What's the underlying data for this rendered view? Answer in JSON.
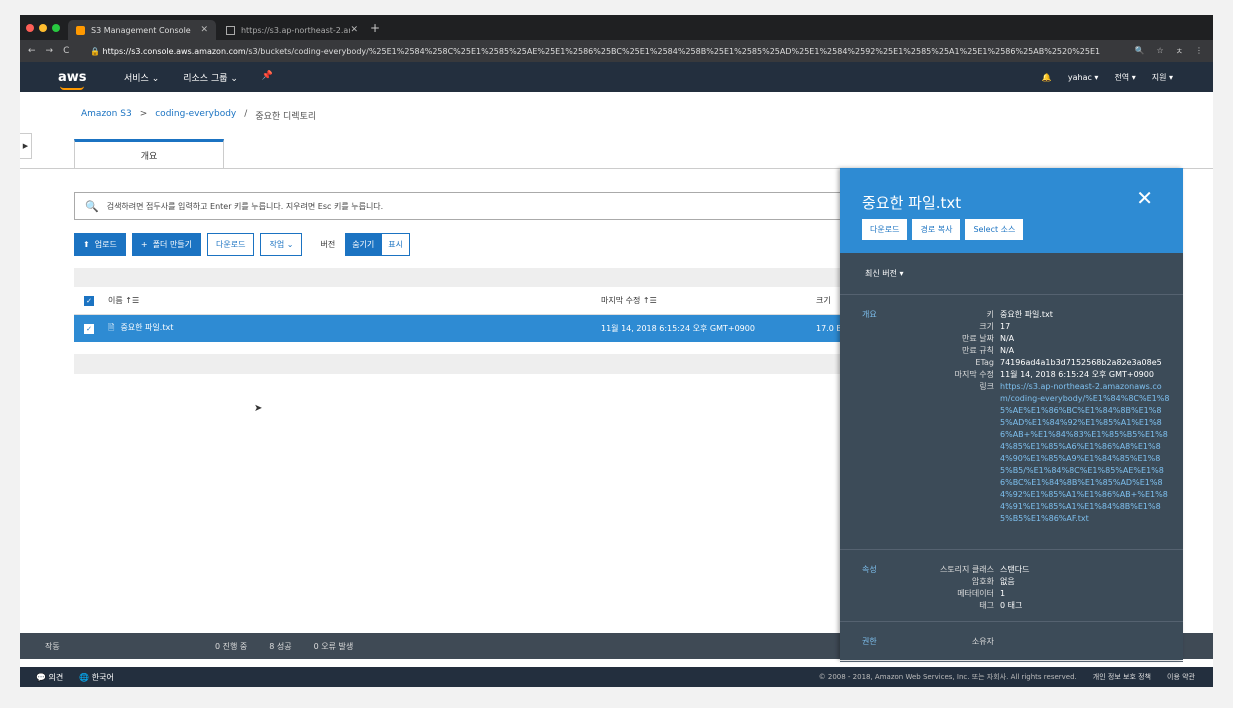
{
  "browser": {
    "tabs": [
      {
        "label": "S3 Management Console"
      },
      {
        "label": "https://s3.ap-northeast-2.ama"
      }
    ],
    "url_host": "https://s3.console.aws.amazon.com",
    "url_path": "/s3/buckets/coding-everybody/%25E1%2584%258C%25E1%2585%25AE%25E1%2586%25BC%25E1%2584%258B%25E1%2585%25AD%25E1%2584%2592%25E1%2585%25A1%25E1%2586%25AB%2520%25E1%..."
  },
  "aws_header": {
    "logo": "aws",
    "nav": [
      "서비스 ⌄",
      "리소스 그룹 ⌄"
    ],
    "user": "yahac ▾",
    "region": "전역 ▾",
    "support": "지원 ▾"
  },
  "breadcrumb": {
    "root": "Amazon S3",
    "sep1": ">",
    "bucket": "coding-everybody",
    "sep2": "/",
    "current": "중요한 디렉토리"
  },
  "tab": {
    "label": "개요"
  },
  "search": {
    "placeholder": "검색하려면 접두사를 입력하고 Enter 키를 누릅니다. 지우려면 Esc 키를 누릅니다."
  },
  "toolbar": {
    "upload": "업로드",
    "create_folder": "폴더 만들기",
    "download": "다운로드",
    "actions": "작업 ⌄",
    "version_label": "버전",
    "hide": "숨기기",
    "show": "표시"
  },
  "table": {
    "headers": {
      "name": "이름 ↑☰",
      "modified": "마지막 수정 ↑☰",
      "size": "크기"
    },
    "rows": [
      {
        "name": "중요한 파일.txt",
        "modified": "11월 14, 2018 6:15:24 오후 GMT+0900",
        "size": "17.0 B"
      }
    ]
  },
  "status": {
    "label": "작동",
    "in_progress": "0 진행 중",
    "success": "8 성공",
    "errors": "0 오류 발생"
  },
  "footer": {
    "feedback": "의견",
    "language": "한국어",
    "copyright": "© 2008 - 2018, Amazon Web Services, Inc. 또는 자회사. All rights reserved.",
    "privacy": "개인 정보 보호 정책",
    "terms": "이용 약관"
  },
  "panel": {
    "title": "중요한 파일.txt",
    "buttons": {
      "download": "다운로드",
      "copy_path": "경로 복사",
      "select_source": "Select 소스"
    },
    "version": "최신 버전 ▾",
    "overview": {
      "section": "개요",
      "fields": [
        {
          "k": "키",
          "v": "중요한 파일.txt"
        },
        {
          "k": "크기",
          "v": "17"
        },
        {
          "k": "만료 날짜",
          "v": "N/A"
        },
        {
          "k": "만료 규칙",
          "v": "N/A"
        },
        {
          "k": "ETag",
          "v": "74196ad4a1b3d7152568b2a82e3a08e5"
        },
        {
          "k": "마지막 수정",
          "v": "11월 14, 2018 6:15:24 오후 GMT+0900"
        }
      ],
      "link_label": "링크",
      "link": "https://s3.ap-northeast-2.amazonaws.com/coding-everybody/%E1%84%8C%E1%85%AE%E1%86%BC%E1%84%8B%E1%85%AD%E1%84%92%E1%85%A1%E1%86%AB+%E1%84%83%E1%85%B5%E1%84%85%E1%85%A6%E1%86%A8%E1%84%90%E1%85%A9%E1%84%85%E1%85%B5/%E1%84%8C%E1%85%AE%E1%86%BC%E1%84%8B%E1%85%AD%E1%84%92%E1%85%A1%E1%86%AB+%E1%84%91%E1%85%A1%E1%84%8B%E1%85%B5%E1%86%AF.txt"
    },
    "attributes": {
      "section": "속성",
      "fields": [
        {
          "k": "스토리지 클래스",
          "v": "스탠다드"
        },
        {
          "k": "암호화",
          "v": "없음"
        },
        {
          "k": "메타데이터",
          "v": "1"
        },
        {
          "k": "태그",
          "v": "0 태그"
        }
      ]
    },
    "permissions": {
      "section": "권한",
      "owner": "소유자"
    }
  },
  "colors": {
    "aws_dark": "#232f3e",
    "accent": "#1b73c2",
    "selected_row": "#2e8bd3",
    "panel": "#3c4b58"
  }
}
